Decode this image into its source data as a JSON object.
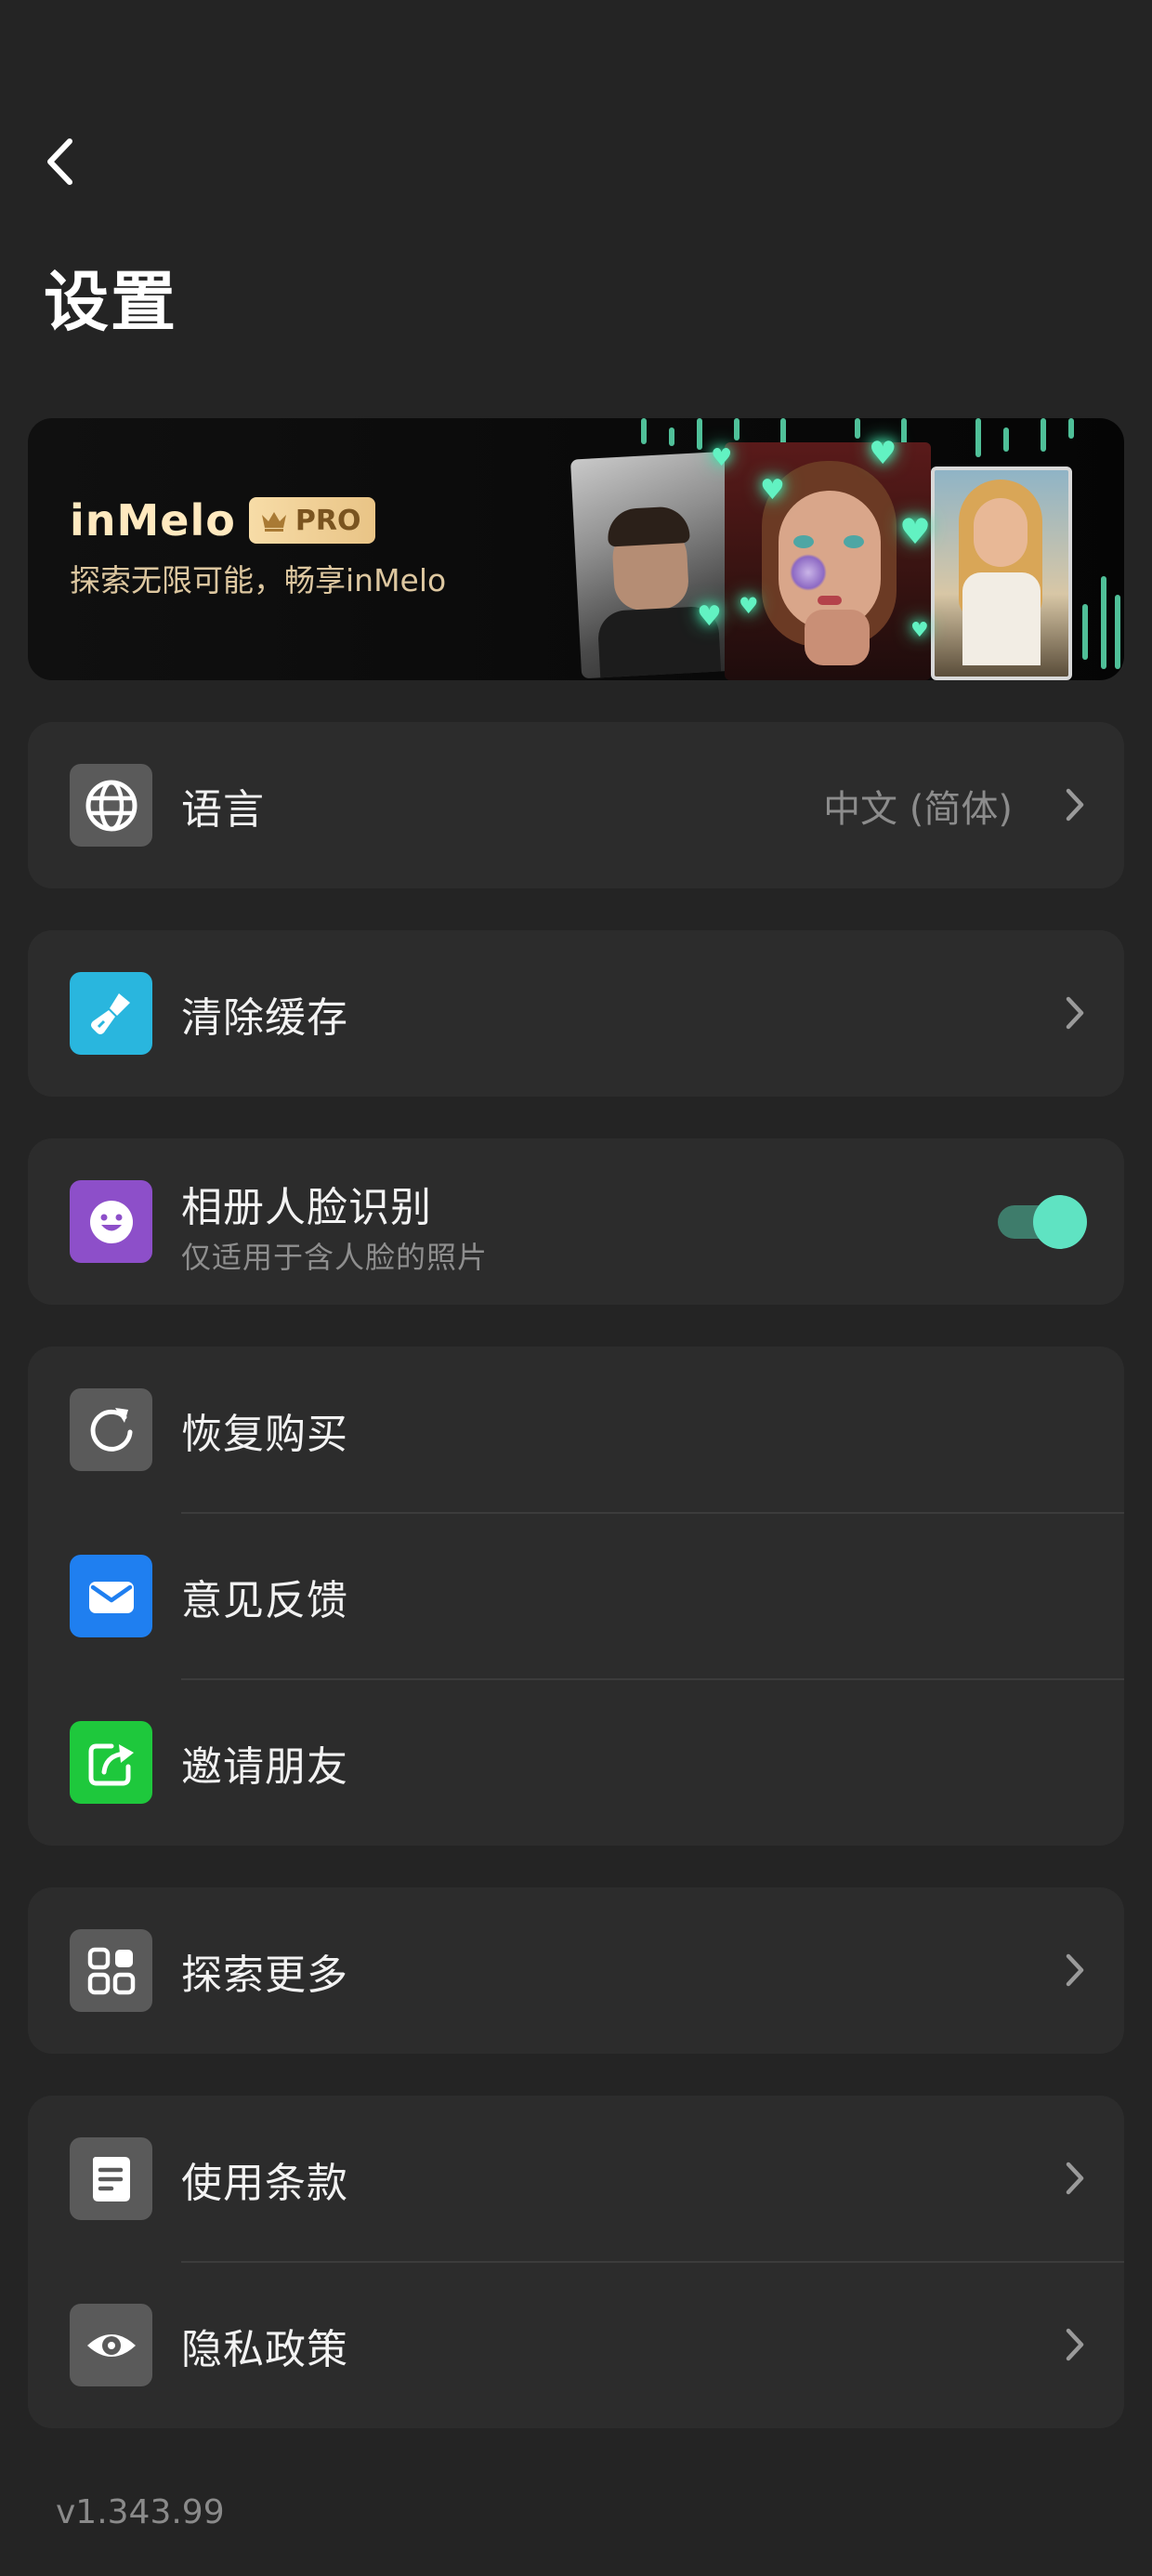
{
  "header": {
    "back_icon": "chevron-left-icon",
    "title": "设置"
  },
  "banner": {
    "brand": "inMelo",
    "badge": "PRO",
    "badge_icon": "crown-icon",
    "subtitle": "探索无限可能，畅享inMelo",
    "accent": "#5de0b3"
  },
  "settings": {
    "language": {
      "label": "语言",
      "value": "中文 (简体)",
      "icon": "globe-icon"
    },
    "clear_cache": {
      "label": "清除缓存",
      "icon": "broom-icon"
    },
    "face_recognition": {
      "label": "相册人脸识别",
      "sublabel": "仅适用于含人脸的照片",
      "icon": "smiley-face-icon",
      "enabled": true
    },
    "restore_purchase": {
      "label": "恢复购买",
      "icon": "refresh-icon"
    },
    "feedback": {
      "label": "意见反馈",
      "icon": "mail-icon"
    },
    "invite_friends": {
      "label": "邀请朋友",
      "icon": "share-icon"
    },
    "explore_more": {
      "label": "探索更多",
      "icon": "grid-icon"
    },
    "terms": {
      "label": "使用条款",
      "icon": "document-icon"
    },
    "privacy": {
      "label": "隐私政策",
      "icon": "eye-icon"
    }
  },
  "footer": {
    "version": "v1.343.99"
  },
  "colors": {
    "background": "#242424",
    "card": "#2c2c2c",
    "toggle_on": "#5fe3c2",
    "cache_icon_bg": "#29b6de",
    "face_icon_bg": "#8d4fc9",
    "mail_icon_bg": "#1f7ff0",
    "share_icon_bg": "#1ec83c",
    "gray_icon_bg": "#5a5a5a"
  }
}
